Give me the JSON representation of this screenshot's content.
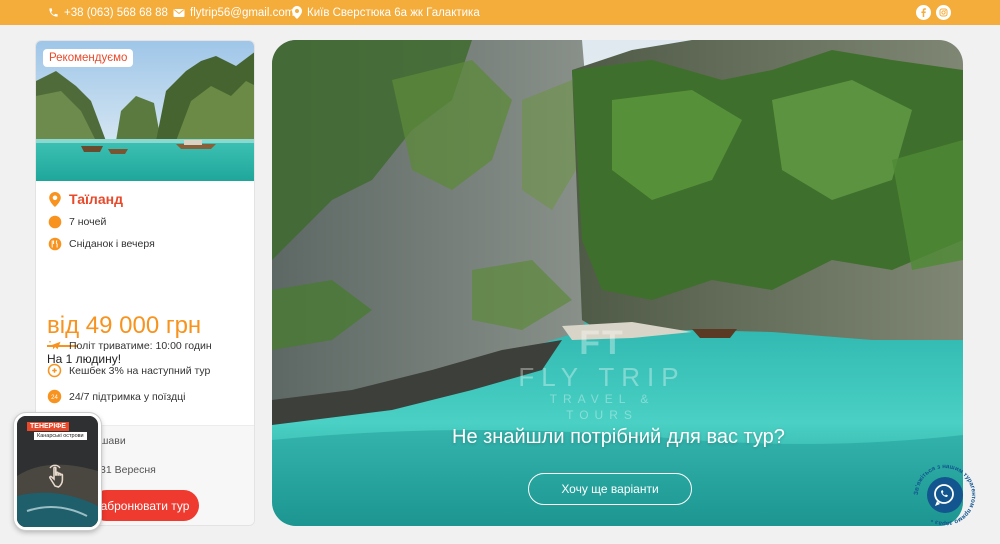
{
  "topbar": {
    "phone": "+38 (063) 568 68 88",
    "email": "flytrip56@gmail.com",
    "address": "Київ Сверстюка 6а жк Галактика",
    "social_icons": [
      "facebook-icon",
      "instagram-icon"
    ]
  },
  "card": {
    "badge": "Рекомендуємо",
    "destination": "Таїланд",
    "nights": "7 ночей",
    "meals": "Сніданок і вечеря",
    "price": "від 49 000 грн",
    "per_person": "На 1 людину!",
    "features": [
      "Політ триватиме: 10:00 годин",
      "Кешбек 3% на наступний тур",
      "24/7 підтримка у поїздці"
    ],
    "departure_city_partial": "шави",
    "date_partial": "31 Вересня",
    "book_button": "абронювати тур"
  },
  "hero": {
    "watermark_mark": "FT",
    "watermark_name": "FLY TRIP",
    "watermark_sub": "TRAVEL & TOURS",
    "title": "Не знайшли потрібний для вас тур?",
    "button": "Хочу ще варіанти"
  },
  "story": {
    "label": "ТЕНЕРІФЕ",
    "sublabel": "Канарські острови"
  },
  "chat": {
    "circle_text": "Зв'яжіться з нашим турагентом прямо зараз • "
  },
  "colors": {
    "topbar": "#f4ac3a",
    "accent_orange": "#f7931e",
    "accent_red": "#e8492a",
    "book_button": "#ee3a2f",
    "chat_blue": "#12558f"
  }
}
